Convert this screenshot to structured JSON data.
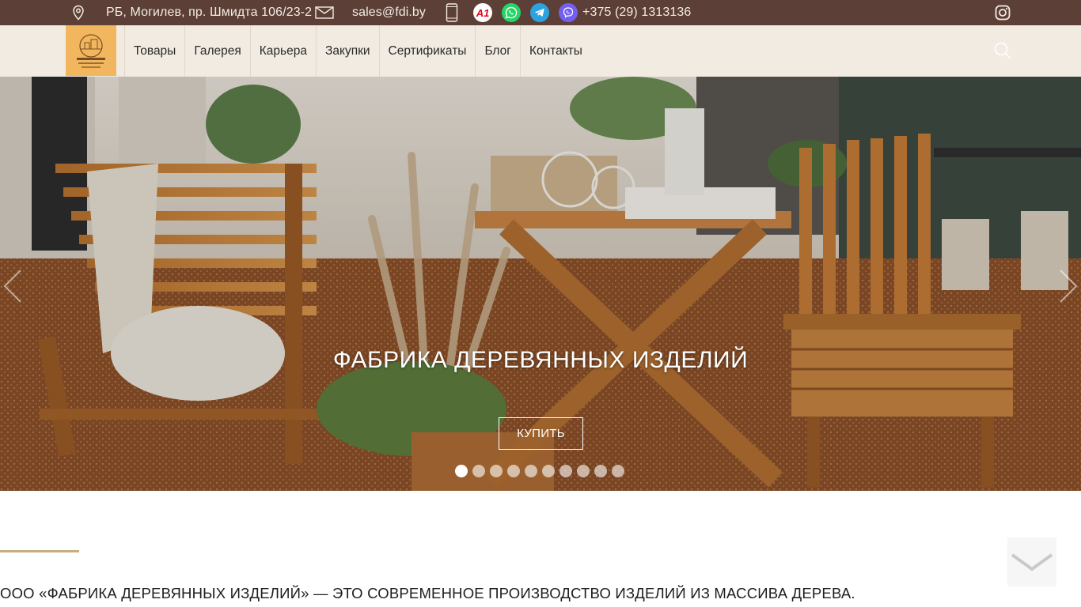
{
  "topbar": {
    "address": "РБ, Могилев, пр. Шмидта 106/23-2",
    "email": "sales@fdi.by",
    "phone": "+375 (29) 1313136",
    "operator_label": "A1",
    "colors": {
      "background": "#5c3f36",
      "whatsapp": "#25d366",
      "telegram": "#2aa3e0",
      "viber": "#7360f2",
      "a1": "#e2001a"
    },
    "icons": [
      "location-pin-icon",
      "envelope-icon",
      "mobile-phone-icon",
      "a1-operator-icon",
      "whatsapp-icon",
      "telegram-icon",
      "viber-icon",
      "instagram-icon"
    ]
  },
  "nav": {
    "logo_alt": "Фабрика деревянных изделий",
    "items": [
      "Товары",
      "Галерея",
      "Карьера",
      "Закупки",
      "Сертификаты",
      "Блог",
      "Контакты"
    ]
  },
  "hero": {
    "title": "ФАБРИКА ДЕРЕВЯННЫХ ИЗДЕЛИЙ",
    "button": "КУПИТЬ",
    "slides_count": 10,
    "active_slide": 1
  },
  "intro": {
    "text": "ООО «ФАБРИКА ДЕРЕВЯННЫХ ИЗДЕЛИЙ» — ЭТО СОВРЕМЕННОЕ ПРОИЗВОДСТВО ИЗДЕЛИЙ ИЗ МАССИВА ДЕРЕВА."
  }
}
